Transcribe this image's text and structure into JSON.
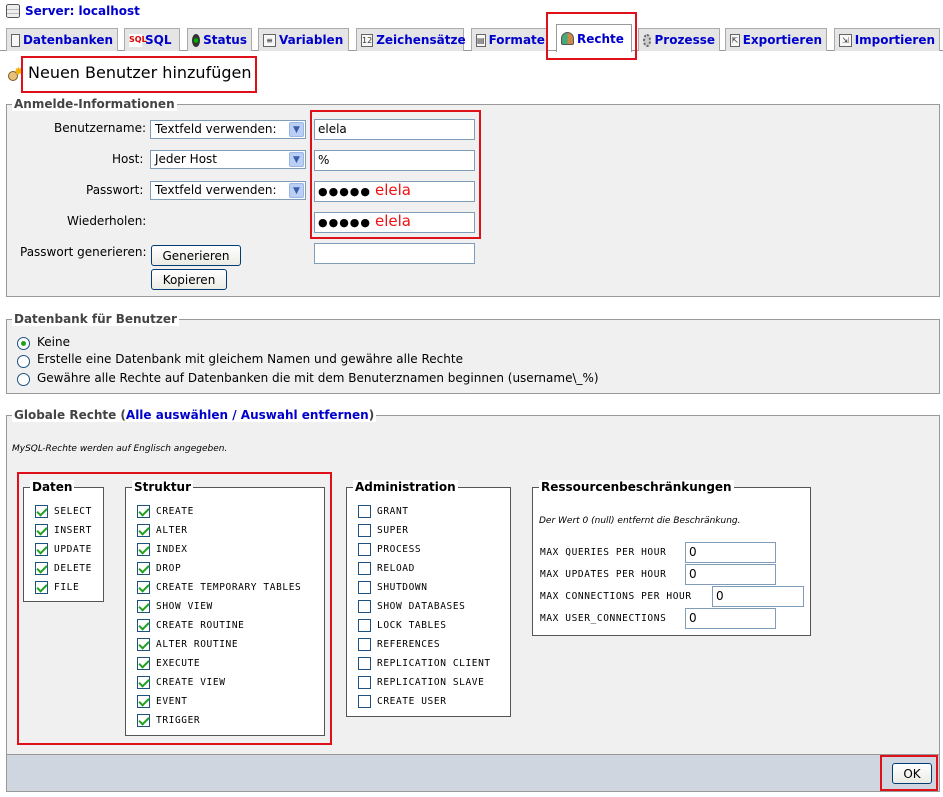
{
  "header": {
    "server_label": "Server: localhost"
  },
  "tabs": [
    {
      "label": "Datenbanken",
      "icon": "databases-icon"
    },
    {
      "label": "SQL",
      "icon": "sql-icon"
    },
    {
      "label": "Status",
      "icon": "status-icon"
    },
    {
      "label": "Variablen",
      "icon": "variables-icon"
    },
    {
      "label": "Zeichensätze",
      "icon": "charsets-icon"
    },
    {
      "label": "Formate",
      "icon": "engines-icon"
    },
    {
      "label": "Rechte",
      "icon": "users-icon",
      "active": true
    },
    {
      "label": "Prozesse",
      "icon": "processes-icon"
    },
    {
      "label": "Exportieren",
      "icon": "export-icon"
    },
    {
      "label": "Importieren",
      "icon": "import-icon"
    }
  ],
  "page_title": "Neuen Benutzer hinzufügen",
  "login": {
    "legend": "Anmelde-Informationen",
    "username_label": "Benutzername:",
    "username_select": "Textfeld verwenden:",
    "username_value": "elela",
    "host_label": "Host:",
    "host_select": "Jeder Host",
    "host_value": "%",
    "password_label": "Passwort:",
    "password_select": "Textfeld verwenden:",
    "password_dots": "●●●●●",
    "password_annotation": "elela",
    "repeat_label": "Wiederholen:",
    "repeat_dots": "●●●●●",
    "repeat_annotation": "elela",
    "generate_label": "Passwort generieren:",
    "generate_button": "Generieren",
    "copy_button": "Kopieren",
    "generated_value": ""
  },
  "database": {
    "legend": "Datenbank für Benutzer",
    "options": [
      {
        "label": "Keine",
        "selected": true
      },
      {
        "label": "Erstelle eine Datenbank mit gleichem Namen und gewähre alle Rechte",
        "selected": false
      },
      {
        "label": "Gewähre alle Rechte auf Datenbanken die mit dem Benuterznamen beginnen (username\\_%)",
        "selected": false
      }
    ]
  },
  "global": {
    "legend_prefix": "Globale Rechte (",
    "select_all": "Alle auswählen",
    "separator": " / ",
    "deselect_all": "Auswahl entfernen",
    "legend_suffix": ")",
    "note": "MySQL-Rechte werden auf Englisch angegeben.",
    "groups": {
      "data": {
        "legend": "Daten",
        "items": [
          {
            "label": "SELECT",
            "checked": true
          },
          {
            "label": "INSERT",
            "checked": true
          },
          {
            "label": "UPDATE",
            "checked": true
          },
          {
            "label": "DELETE",
            "checked": true
          },
          {
            "label": "FILE",
            "checked": true
          }
        ]
      },
      "structure": {
        "legend": "Struktur",
        "items": [
          {
            "label": "CREATE",
            "checked": true
          },
          {
            "label": "ALTER",
            "checked": true
          },
          {
            "label": "INDEX",
            "checked": true
          },
          {
            "label": "DROP",
            "checked": true
          },
          {
            "label": "CREATE TEMPORARY TABLES",
            "checked": true
          },
          {
            "label": "SHOW VIEW",
            "checked": true
          },
          {
            "label": "CREATE ROUTINE",
            "checked": true
          },
          {
            "label": "ALTER ROUTINE",
            "checked": true
          },
          {
            "label": "EXECUTE",
            "checked": true
          },
          {
            "label": "CREATE VIEW",
            "checked": true
          },
          {
            "label": "EVENT",
            "checked": true
          },
          {
            "label": "TRIGGER",
            "checked": true
          }
        ]
      },
      "admin": {
        "legend": "Administration",
        "items": [
          {
            "label": "GRANT",
            "checked": false
          },
          {
            "label": "SUPER",
            "checked": false
          },
          {
            "label": "PROCESS",
            "checked": false
          },
          {
            "label": "RELOAD",
            "checked": false
          },
          {
            "label": "SHUTDOWN",
            "checked": false
          },
          {
            "label": "SHOW DATABASES",
            "checked": false
          },
          {
            "label": "LOCK TABLES",
            "checked": false
          },
          {
            "label": "REFERENCES",
            "checked": false
          },
          {
            "label": "REPLICATION CLIENT",
            "checked": false
          },
          {
            "label": "REPLICATION SLAVE",
            "checked": false
          },
          {
            "label": "CREATE USER",
            "checked": false
          }
        ]
      },
      "resources": {
        "legend": "Ressourcenbeschränkungen",
        "note": "Der Wert 0 (null) entfernt die Beschränkung.",
        "items": [
          {
            "label": "MAX QUERIES PER HOUR",
            "value": "0"
          },
          {
            "label": "MAX UPDATES PER HOUR",
            "value": "0"
          },
          {
            "label": "MAX CONNECTIONS PER HOUR",
            "value": "0"
          },
          {
            "label": "MAX USER_CONNECTIONS",
            "value": "0"
          }
        ]
      }
    }
  },
  "footer": {
    "ok_button": "OK"
  },
  "colors": {
    "annotation_red": "#e0101a",
    "link_blue": "#0000cc",
    "check_green": "#21a121"
  }
}
